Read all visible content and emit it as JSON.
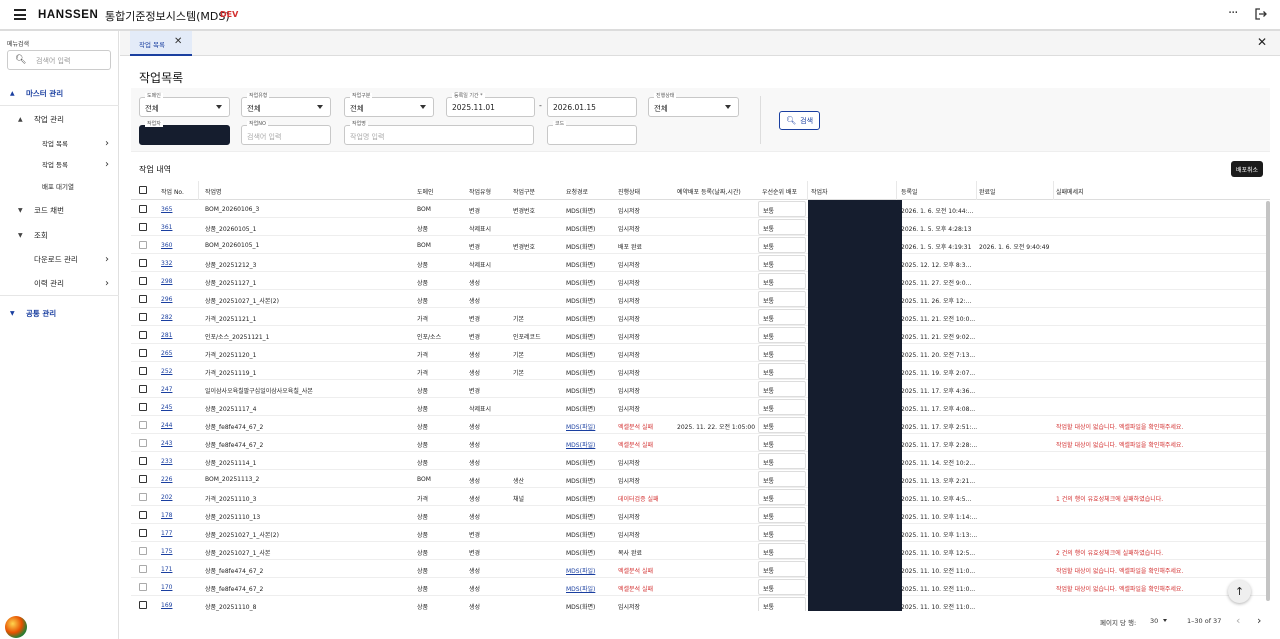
{
  "app": {
    "logo": "HANSSEN",
    "title": "통합기준정보시스템(MDS)",
    "env": "DEV",
    "more_label": "···"
  },
  "sidebar": {
    "search_label": "메뉴검색",
    "search_placeholder": "검색어 입력",
    "items": [
      {
        "label": "마스터 관리",
        "arrow": "▲"
      },
      {
        "label": "작업 관리",
        "arrow": "▲"
      },
      {
        "label": "작업 목록",
        "chevron": "›"
      },
      {
        "label": "작업 등록",
        "chevron": "›"
      },
      {
        "label": "배포 대기열"
      },
      {
        "label": "코드 채번",
        "arrow": "▼"
      },
      {
        "label": "조회",
        "arrow": "▼"
      },
      {
        "label": "다운로드 관리",
        "chevron": "›"
      },
      {
        "label": "이력 관리",
        "chevron": "›"
      },
      {
        "label": "공통 관리",
        "arrow": "▼"
      }
    ]
  },
  "tabs": [
    {
      "label": "작업 목록",
      "close": "✕"
    }
  ],
  "close_all": "✕",
  "page_title": "작업목록",
  "filters": {
    "domain": {
      "label": "도메인",
      "value": "전체"
    },
    "work_type": {
      "label": "작업유형",
      "value": "전체"
    },
    "work_category": {
      "label": "작업구분",
      "value": "전체"
    },
    "reg_period": {
      "label": "등록일 기간 *",
      "from": "2025.11.01",
      "to": "2026.01.15",
      "dash": "-"
    },
    "status": {
      "label": "진행상태",
      "value": "전체"
    },
    "worker": {
      "label": "작업자"
    },
    "work_no": {
      "label": "작업NO",
      "placeholder": "검색어 입력"
    },
    "work_name": {
      "label": "작업명",
      "placeholder": "작업명 입력"
    },
    "code": {
      "label": "코드"
    },
    "search_button": "검색"
  },
  "section_title": "작업 내역",
  "cancel_deploy_button": "배포취소",
  "table": {
    "headers": [
      "작업 No.",
      "작업명",
      "도메인",
      "작업유형",
      "작업구분",
      "요청경로",
      "진행상태",
      "예약배포 등록(날짜,시간)",
      "우선순위 배포",
      "작업자",
      "등록일",
      "완료일",
      "실패메세지"
    ],
    "rows": [
      {
        "no": "365",
        "name": "BOM_20260106_3",
        "domain": "BOM",
        "type": "변경",
        "cat": "변경번호",
        "path": "MDS(화면)",
        "status": "임시저장",
        "sched": "",
        "pri": "보통",
        "reg": "2026. 1. 6. 오전 10:44:...",
        "done": "",
        "msg": ""
      },
      {
        "no": "361",
        "name": "상품_20260105_1",
        "domain": "상품",
        "type": "삭제표시",
        "cat": "",
        "path": "MDS(화면)",
        "status": "임시저장",
        "sched": "",
        "pri": "보통",
        "reg": "2026. 1. 5. 오후 4:28:13",
        "done": "",
        "msg": ""
      },
      {
        "no": "360",
        "name": "BOM_20260105_1",
        "domain": "BOM",
        "type": "변경",
        "cat": "변경번호",
        "path": "MDS(화면)",
        "status": "배포 완료",
        "sched": "",
        "pri": "보통",
        "reg": "2026. 1. 5. 오후 4:19:31",
        "done": "2026. 1. 6. 오전 9:40:49",
        "msg": ""
      },
      {
        "no": "332",
        "name": "상품_20251212_3",
        "domain": "상품",
        "type": "삭제표시",
        "cat": "",
        "path": "MDS(화면)",
        "status": "임시저장",
        "sched": "",
        "pri": "보통",
        "reg": "2025. 12. 12. 오후 8:3...",
        "done": "",
        "msg": ""
      },
      {
        "no": "298",
        "name": "상품_20251127_1",
        "domain": "상품",
        "type": "생성",
        "cat": "",
        "path": "MDS(화면)",
        "status": "임시저장",
        "sched": "",
        "pri": "보통",
        "reg": "2025. 11. 27. 오전 9:0...",
        "done": "",
        "msg": ""
      },
      {
        "no": "296",
        "name": "상품_20251027_1_사본(2)",
        "domain": "상품",
        "type": "생성",
        "cat": "",
        "path": "MDS(화면)",
        "status": "임시저장",
        "sched": "",
        "pri": "보통",
        "reg": "2025. 11. 26. 오후 12:...",
        "done": "",
        "msg": ""
      },
      {
        "no": "282",
        "name": "가격_20251121_1",
        "domain": "가격",
        "type": "변경",
        "cat": "기본",
        "path": "MDS(화면)",
        "status": "임시저장",
        "sched": "",
        "pri": "보통",
        "reg": "2025. 11. 21. 오전 10:0...",
        "done": "",
        "msg": ""
      },
      {
        "no": "281",
        "name": "인포/소스_20251121_1",
        "domain": "인포/소스",
        "type": "변경",
        "cat": "인포레코드",
        "path": "MDS(화면)",
        "status": "임시저장",
        "sched": "",
        "pri": "보통",
        "reg": "2025. 11. 21. 오전 9:02...",
        "done": "",
        "msg": ""
      },
      {
        "no": "265",
        "name": "가격_20251120_1",
        "domain": "가격",
        "type": "생성",
        "cat": "기본",
        "path": "MDS(화면)",
        "status": "임시저장",
        "sched": "",
        "pri": "보통",
        "reg": "2025. 11. 20. 오전 7:13...",
        "done": "",
        "msg": ""
      },
      {
        "no": "252",
        "name": "가격_20251119_1",
        "domain": "가격",
        "type": "생성",
        "cat": "기본",
        "path": "MDS(화면)",
        "status": "임시저장",
        "sched": "",
        "pri": "보통",
        "reg": "2025. 11. 19. 오후 2:07...",
        "done": "",
        "msg": ""
      },
      {
        "no": "247",
        "name": "일이삼사오육칠팔구십일이삼사오육칠_사본",
        "domain": "상품",
        "type": "변경",
        "cat": "",
        "path": "MDS(화면)",
        "status": "임시저장",
        "sched": "",
        "pri": "보통",
        "reg": "2025. 11. 17. 오후 4:36...",
        "done": "",
        "msg": ""
      },
      {
        "no": "245",
        "name": "상품_20251117_4",
        "domain": "상품",
        "type": "삭제표시",
        "cat": "",
        "path": "MDS(화면)",
        "status": "임시저장",
        "sched": "",
        "pri": "보통",
        "reg": "2025. 11. 17. 오후 4:08...",
        "done": "",
        "msg": ""
      },
      {
        "no": "244",
        "name": "상품_fe8fe474_67_2",
        "domain": "상품",
        "type": "생성",
        "cat": "",
        "path": "MDS(파일)",
        "status": "엑셀분석 실패",
        "sched": "2025. 11. 22. 오전 1:05:00",
        "pri": "보통",
        "reg": "2025. 11. 17. 오후 2:51:...",
        "done": "",
        "msg": "작업할 대상이 없습니다. 엑셀파일을 확인해주세요."
      },
      {
        "no": "243",
        "name": "상품_fe8fe474_67_2",
        "domain": "상품",
        "type": "생성",
        "cat": "",
        "path": "MDS(파일)",
        "status": "엑셀분석 실패",
        "sched": "",
        "pri": "보통",
        "reg": "2025. 11. 17. 오후 2:28:...",
        "done": "",
        "msg": "작업할 대상이 없습니다. 엑셀파일을 확인해주세요."
      },
      {
        "no": "233",
        "name": "상품_20251114_1",
        "domain": "상품",
        "type": "생성",
        "cat": "",
        "path": "MDS(화면)",
        "status": "임시저장",
        "sched": "",
        "pri": "보통",
        "reg": "2025. 11. 14. 오전 10:2...",
        "done": "",
        "msg": ""
      },
      {
        "no": "226",
        "name": "BOM_20251113_2",
        "domain": "BOM",
        "type": "생성",
        "cat": "생산",
        "path": "MDS(화면)",
        "status": "임시저장",
        "sched": "",
        "pri": "보통",
        "reg": "2025. 11. 13. 오후 2:21...",
        "done": "",
        "msg": ""
      },
      {
        "no": "202",
        "name": "가격_20251110_3",
        "domain": "가격",
        "type": "생성",
        "cat": "채널",
        "path": "MDS(화면)",
        "status": "데이터검증 실패",
        "sched": "",
        "pri": "보통",
        "reg": "2025. 11. 10. 오후 4:5...",
        "done": "",
        "msg": "1 건의 행이 유효성체크에 실패하였습니다."
      },
      {
        "no": "178",
        "name": "상품_20251110_13",
        "domain": "상품",
        "type": "생성",
        "cat": "",
        "path": "MDS(화면)",
        "status": "임시저장",
        "sched": "",
        "pri": "보통",
        "reg": "2025. 11. 10. 오후 1:14:...",
        "done": "",
        "msg": ""
      },
      {
        "no": "177",
        "name": "상품_20251027_1_사본(2)",
        "domain": "상품",
        "type": "변경",
        "cat": "",
        "path": "MDS(화면)",
        "status": "임시저장",
        "sched": "",
        "pri": "보통",
        "reg": "2025. 11. 10. 오후 1:13:...",
        "done": "",
        "msg": ""
      },
      {
        "no": "175",
        "name": "상품_20251027_1_사본",
        "domain": "상품",
        "type": "변경",
        "cat": "",
        "path": "MDS(화면)",
        "status": "복사 완료",
        "sched": "",
        "pri": "보통",
        "reg": "2025. 11. 10. 오후 12:5...",
        "done": "",
        "msg": "2 건의 행이 유효성체크에 실패하였습니다."
      },
      {
        "no": "171",
        "name": "상품_fe8fe474_67_2",
        "domain": "상품",
        "type": "생성",
        "cat": "",
        "path": "MDS(파일)",
        "status": "엑셀분석 실패",
        "sched": "",
        "pri": "보통",
        "reg": "2025. 11. 10. 오전 11:0...",
        "done": "",
        "msg": "작업할 대상이 없습니다. 엑셀파일을 확인해주세요."
      },
      {
        "no": "170",
        "name": "상품_fe8fe474_67_2",
        "domain": "상품",
        "type": "생성",
        "cat": "",
        "path": "MDS(파일)",
        "status": "엑셀분석 실패",
        "sched": "",
        "pri": "보통",
        "reg": "2025. 11. 10. 오전 11:0...",
        "done": "",
        "msg": "작업할 대상이 없습니다. 엑셀파일을 확인해주세요."
      },
      {
        "no": "169",
        "name": "상품_20251110_8",
        "domain": "상품",
        "type": "생성",
        "cat": "",
        "path": "MDS(화면)",
        "status": "임시저장",
        "sched": "",
        "pri": "보통",
        "reg": "2025. 11. 10. 오전 11:0...",
        "done": "",
        "msg": ""
      }
    ]
  },
  "pagination": {
    "rows_per_page_label": "페이지 당 행:",
    "rows_per_page": "30",
    "range": "1–30 of 37",
    "prev": "‹",
    "next": "›"
  },
  "fab_icon": "↑",
  "colors": {
    "accent": "#1a3fa0",
    "error": "#d32f2f",
    "env": "#d32f2f",
    "redaction": "#151d2e"
  }
}
